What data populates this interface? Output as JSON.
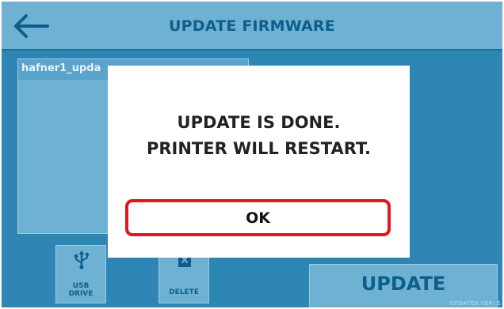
{
  "header": {
    "title": "UPDATE FIRMWARE",
    "back_icon": "arrow-left-icon"
  },
  "file_list": {
    "items": [
      "hafner1_upda"
    ]
  },
  "toolbar": {
    "usb_label_line1": "USB",
    "usb_label_line2": "DRIVE",
    "usb_icon": "usb-icon",
    "delete_label": "DELETE",
    "delete_icon": "delete-file-icon",
    "update_label": "UPDATE"
  },
  "footer": {
    "version": "UPDATER VER: 1"
  },
  "dialog": {
    "line1": "UPDATE IS DONE.",
    "line2": "PRINTER WILL RESTART.",
    "ok_label": "OK"
  },
  "colors": {
    "background": "#2e86b5",
    "header": "#6fb1d3",
    "text_accent": "#0c5f8d",
    "highlight": "#e0171c"
  }
}
